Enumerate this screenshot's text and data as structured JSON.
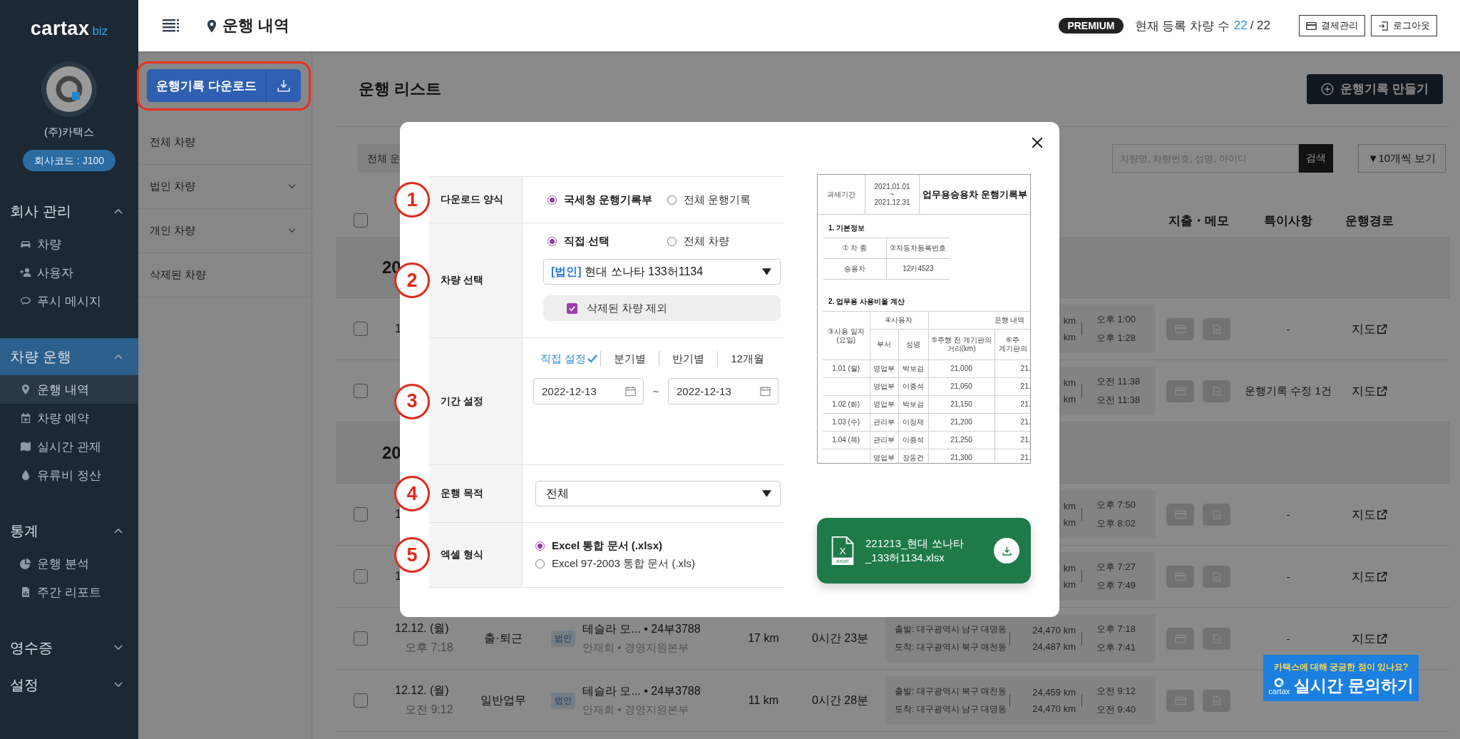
{
  "sidebar": {
    "logo": "cartax",
    "logo_suffix": "biz",
    "company": "(주)카택스",
    "company_code": "회사코드 : J100",
    "sections": [
      {
        "title": "회사 관리",
        "expanded": true,
        "selected": false,
        "items": [
          {
            "label": "차량",
            "selected": false
          },
          {
            "label": "사용자",
            "selected": false
          },
          {
            "label": "푸시 메시지",
            "selected": false
          }
        ]
      },
      {
        "title": "차량 운행",
        "expanded": true,
        "selected": true,
        "items": [
          {
            "label": "운행 내역",
            "selected": true
          },
          {
            "label": "차량 예약",
            "selected": false
          },
          {
            "label": "실시간 관제",
            "selected": false
          },
          {
            "label": "유류비 정산",
            "selected": false
          }
        ]
      },
      {
        "title": "통계",
        "expanded": true,
        "selected": false,
        "items": [
          {
            "label": "운행 분석",
            "selected": false
          },
          {
            "label": "주간 리포트",
            "selected": false
          }
        ]
      },
      {
        "title": "영수증",
        "expanded": false,
        "selected": false
      },
      {
        "title": "설정",
        "expanded": false,
        "selected": false
      }
    ]
  },
  "top_bar": {
    "title": "운행 내역",
    "plan": "PREMIUM",
    "count_label": "현재 등록 차량 수",
    "count": "22",
    "count_total": "/ 22",
    "buttons": [
      "결제관리",
      "로그아웃"
    ]
  },
  "vehicle_panel": {
    "download_button": "운행기록 다운로드",
    "highlighted": true,
    "items": [
      {
        "label": "전체 차량",
        "expandable": false
      },
      {
        "label": "법인 차량",
        "expandable": true
      },
      {
        "label": "개인 차량",
        "expandable": true
      },
      {
        "label": "삭제된 차량",
        "expandable": false
      }
    ]
  },
  "trip_list": {
    "title": "운행 리스트",
    "create_button": "운행기록 만들기",
    "filter": "전체 운",
    "search_placeholder": "차량명, 차량번호, 성명, 아이디",
    "search_button": "검색",
    "page_size": "▼10개씩 보기",
    "header_checked": false,
    "columns": [
      "지출・메모",
      "특이사항",
      "운행경로"
    ],
    "rows": [
      {
        "kind": "group",
        "label": "20"
      },
      {
        "kind": "trip",
        "checked": false,
        "date": "1",
        "odometer": [
          "km",
          "km"
        ],
        "times": [
          "오후 1:00",
          "오후 1:28"
        ],
        "remark": "-",
        "route": "지도"
      },
      {
        "kind": "trip",
        "checked": false,
        "odometer": [
          "km",
          "km"
        ],
        "times": [
          "오전 11:38",
          "오전 11:38"
        ],
        "remark": "운행기록 수정 1건",
        "route": "지도"
      },
      {
        "kind": "group",
        "label": "20"
      },
      {
        "kind": "trip",
        "checked": false,
        "date": "1",
        "odometer": [
          "km",
          "km"
        ],
        "times": [
          "오후 7:50",
          "오후 8:02"
        ],
        "remark": "-",
        "route": "지도"
      },
      {
        "kind": "trip",
        "checked": false,
        "date": "1",
        "odometer": [
          "km",
          "km"
        ],
        "times": [
          "오후 7:27",
          "오후 7:49"
        ],
        "remark": "-",
        "route": "지도"
      },
      {
        "kind": "trip",
        "checked": false,
        "date": "12.12. (월)",
        "time": "오후 7:18",
        "purpose": "출·퇴근",
        "badge": "법인",
        "vehicle": "테슬라 모... • 24부3788",
        "driver": "안재희 • 경영지원본부",
        "distance": "17 km",
        "duration": "0시간 23분",
        "addresses": [
          "출발: 대구광역시 남구 대명동",
          "도착: 대구광역시 북구 매천동"
        ],
        "odometer": [
          "24,470 km",
          "24,487 km"
        ],
        "times": [
          "오후 7:18",
          "오후 7:41"
        ],
        "remark": "-",
        "route": "지도"
      },
      {
        "kind": "trip",
        "checked": false,
        "date": "12.12. (월)",
        "time": "오전 9:12",
        "purpose": "일반업무",
        "badge": "법인",
        "vehicle": "테슬라 모... • 24부3788",
        "driver": "안재희 • 경영지원본부",
        "distance": "11 km",
        "duration": "0시간 28분",
        "addresses": [
          "출발: 대구광역시 북구 매천동",
          "도착: 대구광역시 남구 대명동"
        ],
        "odometer": [
          "24,459 km",
          "24,470 km"
        ],
        "times": [
          "오전 9:12",
          "오전 9:40"
        ]
      }
    ]
  },
  "modal": {
    "form": [
      {
        "step": "1",
        "label": "다운로드 양식",
        "kind": "radio_row",
        "options": [
          {
            "label": "국세청 운행기록부",
            "selected": true
          },
          {
            "label": "전체 운행기록",
            "selected": false
          }
        ]
      },
      {
        "step": "2",
        "label": "차량 선택",
        "kind": "vehicle",
        "options": [
          {
            "label": "직접 선택",
            "selected": true
          },
          {
            "label": "전체 차량",
            "selected": false
          }
        ],
        "select_tag": "[법인]",
        "select_value": "현대 쏘나타  133허1134",
        "exclude_deleted": {
          "label": "삭제된 차량 제외",
          "checked": true
        }
      },
      {
        "step": "3",
        "label": "기간 설정",
        "kind": "period",
        "periods": [
          {
            "label": "직접 설정",
            "selected": true
          },
          {
            "label": "분기별",
            "selected": false
          },
          {
            "label": "반기별",
            "selected": false
          },
          {
            "label": "12개월",
            "selected": false
          }
        ],
        "start": "2022-12-13",
        "separator": "~",
        "end": "2022-12-13"
      },
      {
        "step": "4",
        "label": "운행 목적",
        "kind": "select",
        "value": "전체"
      },
      {
        "step": "5",
        "label": "엑셀 형식",
        "kind": "radio_stack",
        "options": [
          {
            "label": "Excel 통합 문서 (.xlsx)",
            "selected": true
          },
          {
            "label": "Excel 97-2003 통합 문서 (.xls)",
            "selected": false
          }
        ]
      }
    ],
    "preview": {
      "period_label": "과세기간",
      "period_lines": [
        "2021.01.01",
        "~",
        "2021.12.31"
      ],
      "title": "업무용승용차 운행기록부",
      "section_1": "1. 기본정보",
      "basic_headers": [
        "① 차 종",
        "②자동차등록번호"
      ],
      "basic_values": [
        "승용차",
        "12카4523"
      ],
      "section_2": "2. 업무용 사용비율 계산",
      "date_header": "③사용 일자 (요일)",
      "user_header": "④사용자",
      "trip_header": "운행 내역",
      "sub_headers": [
        "부서",
        "성명",
        "⑤주행 전 계기판의 거리(km)",
        "⑥주 계기판의"
      ],
      "rows": [
        [
          "1.01 (월)",
          "영업부",
          "박보검",
          "21,000",
          "21."
        ],
        [
          "",
          "영업부",
          "이종석",
          "21,050",
          "21."
        ],
        [
          "1.02 (화)",
          "영업부",
          "박보검",
          "21,150",
          "21."
        ],
        [
          "1.03 (수)",
          "관리부",
          "이정재",
          "21,200",
          "21."
        ],
        [
          "1.04 (목)",
          "관리부",
          "이종석",
          "21,250",
          "21."
        ],
        [
          "",
          "영업부",
          "장동건",
          "21,300",
          "21."
        ]
      ]
    },
    "file": {
      "icon_letter": "X",
      "icon_caption": "excel",
      "name_lines": [
        "221213_현대 쏘나타",
        "_133허1134.xlsx"
      ]
    }
  },
  "chat_widget": {
    "question": "카택스에 대해 궁금한 점이 있나요?",
    "brand": "cartax",
    "button": "실시간 문의하기"
  }
}
